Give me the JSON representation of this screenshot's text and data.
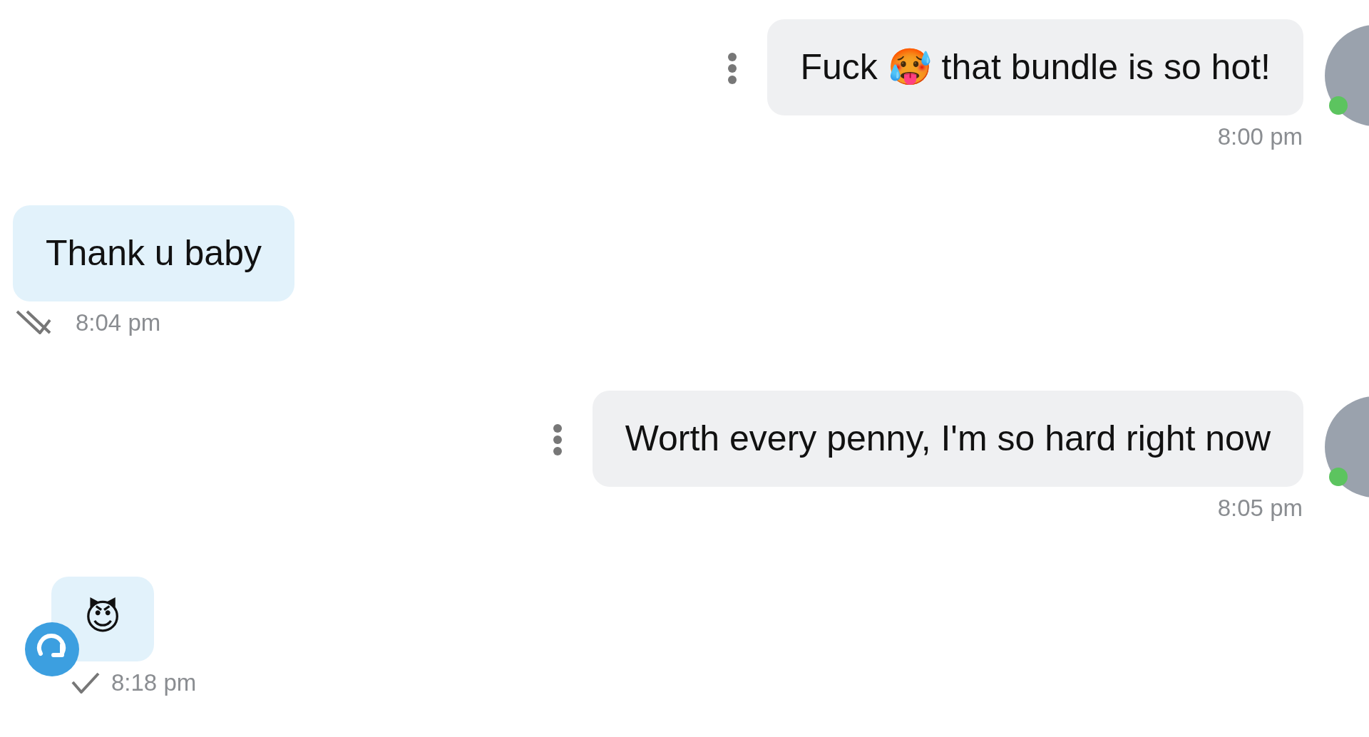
{
  "messages": [
    {
      "kind": "incoming",
      "text": "Fuck 🥵 that bundle is so hot!",
      "time": "8:00 pm",
      "online": true
    },
    {
      "kind": "outgoing",
      "text": "Thank u baby",
      "time": "8:04 pm",
      "read": true
    },
    {
      "kind": "incoming",
      "text": "Worth every penny, I'm so hard right now",
      "time": "8:05 pm",
      "online": true
    },
    {
      "kind": "outgoing",
      "text": "😈",
      "time": "8:18 pm",
      "read": false,
      "resend": true
    }
  ]
}
